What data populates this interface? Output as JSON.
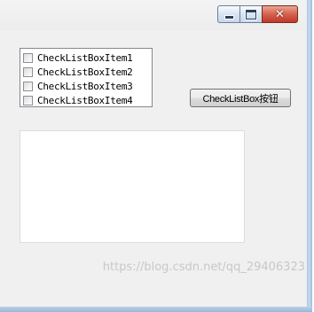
{
  "window": {
    "caption_buttons": {
      "minimize_icon": "minimize-icon",
      "maximize_icon": "maximize-icon",
      "close_icon": "close-icon",
      "close_glyph": "✕"
    }
  },
  "checklist": {
    "items": [
      {
        "label": "CheckListBoxItem1",
        "checked": false
      },
      {
        "label": "CheckListBoxItem2",
        "checked": false
      },
      {
        "label": "CheckListBoxItem3",
        "checked": false
      },
      {
        "label": "CheckListBoxItem4",
        "checked": false
      }
    ]
  },
  "button": {
    "label": "CheckListBox按钮"
  },
  "output_box": {
    "value": ""
  },
  "watermark": "https://blog.csdn.net/qq_29406323",
  "colors": {
    "client_bg": "#f0f0f0",
    "close_button": "#c0392b",
    "frame": "#a9c4e0"
  }
}
